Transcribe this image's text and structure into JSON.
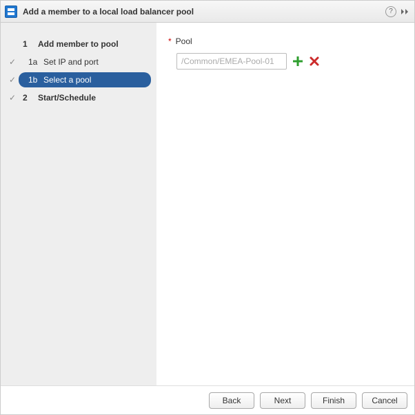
{
  "dialog": {
    "title": "Add a member to a local load balancer pool"
  },
  "sidebar": {
    "steps": [
      {
        "num": "1",
        "text": "Add member to pool",
        "checked": false,
        "sub": false,
        "active": false
      },
      {
        "num": "1a",
        "text": "Set IP and port",
        "checked": true,
        "sub": true,
        "active": false
      },
      {
        "num": "1b",
        "text": "Select a pool",
        "checked": true,
        "sub": true,
        "active": true
      },
      {
        "num": "2",
        "text": "Start/Schedule",
        "checked": true,
        "sub": false,
        "active": false
      }
    ]
  },
  "form": {
    "pool_label": "Pool",
    "pool_placeholder": "/Common/EMEA-Pool-01",
    "pool_value": ""
  },
  "footer": {
    "back": "Back",
    "next": "Next",
    "finish": "Finish",
    "cancel": "Cancel"
  },
  "icons": {
    "help": "?",
    "check": "✓"
  }
}
